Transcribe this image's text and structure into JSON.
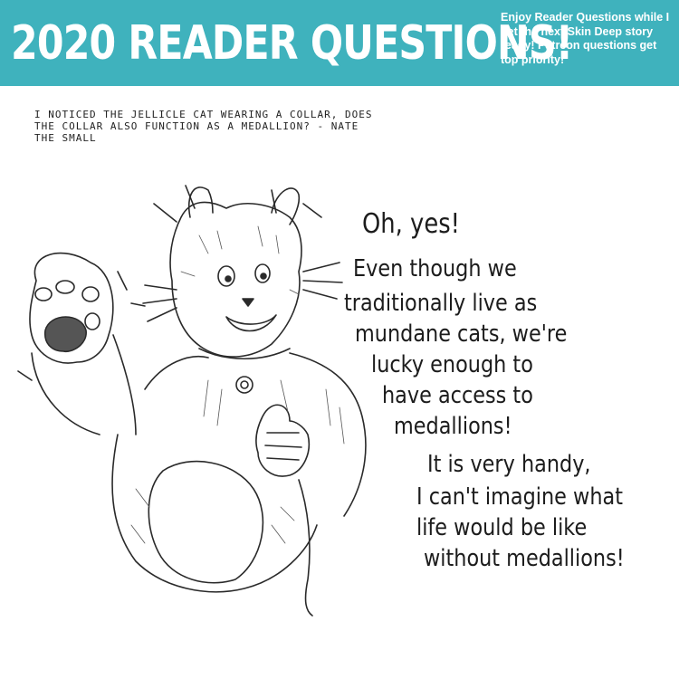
{
  "header": {
    "title": "2020 READER QUESTIONS!",
    "blurb": "Enjoy Reader Questions while I get the next Skin Deep story ready! Patreon questions get top priority!",
    "color": "#3fb2bd"
  },
  "question": {
    "text": "I noticed the Jellicle cat wearing a collar, does the collar also function as a medallion? - Nate the Small"
  },
  "answer": {
    "lines": [
      "Oh, yes!",
      "Even though we",
      "traditionally live as",
      "mundane cats, we're",
      "lucky enough to",
      "have access to",
      "medallions!",
      "It is very handy,",
      "I can't imagine what",
      "life would be like",
      "without medallions!"
    ]
  },
  "illustration": {
    "subject": "cat-character-drawing"
  }
}
